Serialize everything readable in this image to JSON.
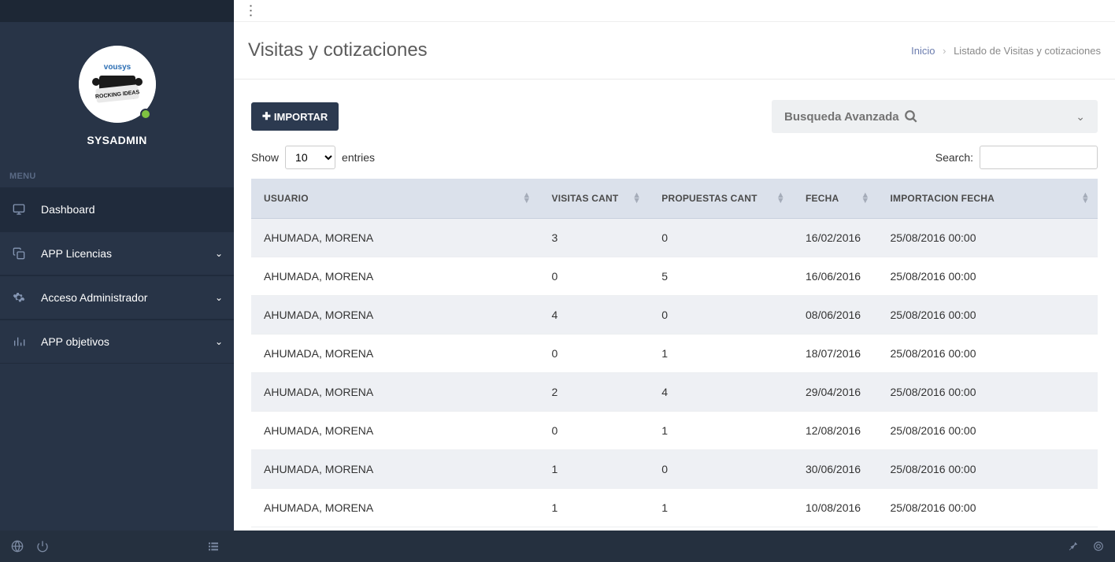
{
  "user": {
    "name": "SYSADMIN"
  },
  "menu_label": "MENU",
  "nav": [
    {
      "label": "Dashboard",
      "icon": "monitor",
      "expandable": false
    },
    {
      "label": "APP Licencias",
      "icon": "copy",
      "expandable": true
    },
    {
      "label": "Acceso Administrador",
      "icon": "gear",
      "expandable": true
    },
    {
      "label": "APP objetivos",
      "icon": "bars",
      "expandable": true
    }
  ],
  "page": {
    "title": "Visitas y cotizaciones",
    "breadcrumb_home": "Inicio",
    "breadcrumb_current": "Listado de Visitas y cotizaciones"
  },
  "actions": {
    "import": "IMPORTAR",
    "adv_search": "Busqueda Avanzada"
  },
  "table_controls": {
    "show": "Show",
    "entries": "entries",
    "length_value": "10",
    "search_label": "Search:"
  },
  "columns": [
    "USUARIO",
    "VISITAS CANT",
    "PROPUESTAS CANT",
    "FECHA",
    "IMPORTACION FECHA"
  ],
  "rows": [
    {
      "usuario": "AHUMADA, MORENA",
      "visitas": "3",
      "propuestas": "0",
      "fecha": "16/02/2016",
      "imp": "25/08/2016 00:00"
    },
    {
      "usuario": "AHUMADA, MORENA",
      "visitas": "0",
      "propuestas": "5",
      "fecha": "16/06/2016",
      "imp": "25/08/2016 00:00"
    },
    {
      "usuario": "AHUMADA, MORENA",
      "visitas": "4",
      "propuestas": "0",
      "fecha": "08/06/2016",
      "imp": "25/08/2016 00:00"
    },
    {
      "usuario": "AHUMADA, MORENA",
      "visitas": "0",
      "propuestas": "1",
      "fecha": "18/07/2016",
      "imp": "25/08/2016 00:00"
    },
    {
      "usuario": "AHUMADA, MORENA",
      "visitas": "2",
      "propuestas": "4",
      "fecha": "29/04/2016",
      "imp": "25/08/2016 00:00"
    },
    {
      "usuario": "AHUMADA, MORENA",
      "visitas": "0",
      "propuestas": "1",
      "fecha": "12/08/2016",
      "imp": "25/08/2016 00:00"
    },
    {
      "usuario": "AHUMADA, MORENA",
      "visitas": "1",
      "propuestas": "0",
      "fecha": "30/06/2016",
      "imp": "25/08/2016 00:00"
    },
    {
      "usuario": "AHUMADA, MORENA",
      "visitas": "1",
      "propuestas": "1",
      "fecha": "10/08/2016",
      "imp": "25/08/2016 00:00"
    }
  ]
}
